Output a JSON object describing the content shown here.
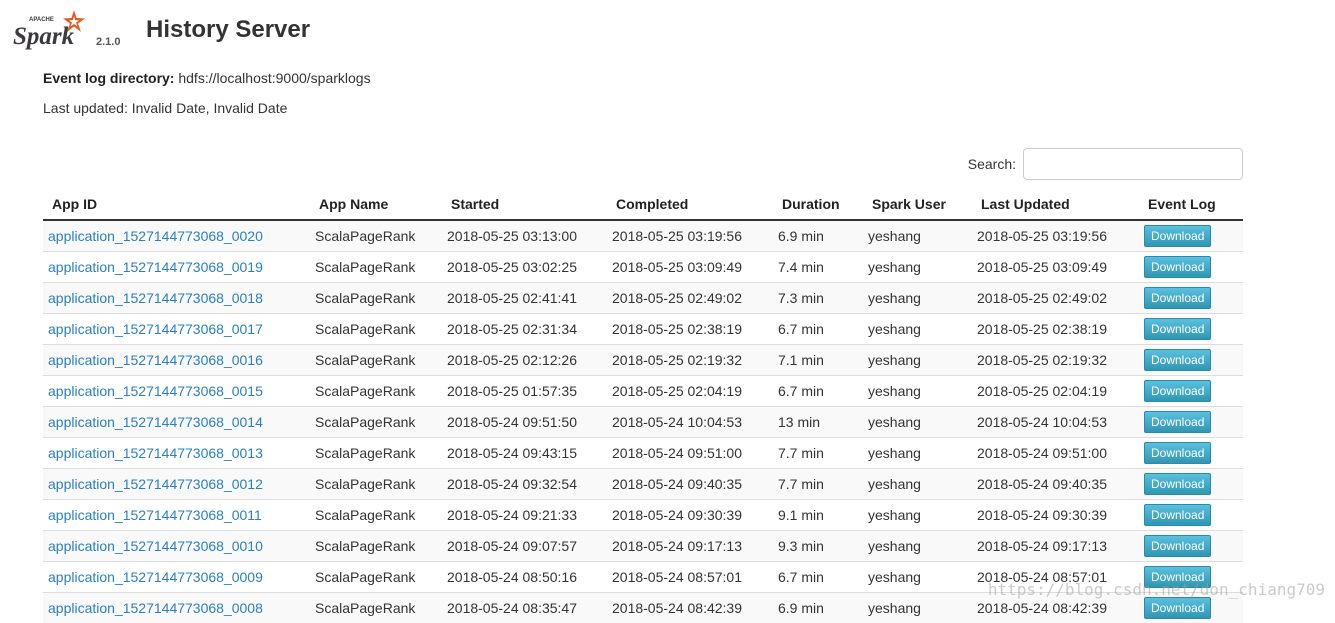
{
  "header": {
    "logo_apache": "APACHE",
    "logo_text": "Spark",
    "version": "2.1.0",
    "title": "History Server"
  },
  "info": {
    "event_log_label": "Event log directory:",
    "event_log_value": "hdfs://localhost:9000/sparklogs",
    "last_updated": "Last updated: Invalid Date, Invalid Date"
  },
  "search": {
    "label": "Search:",
    "value": "",
    "placeholder": ""
  },
  "table": {
    "columns": [
      "App ID",
      "App Name",
      "Started",
      "Completed",
      "Duration",
      "Spark User",
      "Last Updated",
      "Event Log"
    ],
    "download_label": "Download",
    "rows": [
      {
        "app_id": "application_1527144773068_0020",
        "app_name": "ScalaPageRank",
        "started": "2018-05-25 03:13:00",
        "completed": "2018-05-25 03:19:56",
        "duration": "6.9 min",
        "user": "yeshang",
        "last_updated": "2018-05-25 03:19:56"
      },
      {
        "app_id": "application_1527144773068_0019",
        "app_name": "ScalaPageRank",
        "started": "2018-05-25 03:02:25",
        "completed": "2018-05-25 03:09:49",
        "duration": "7.4 min",
        "user": "yeshang",
        "last_updated": "2018-05-25 03:09:49"
      },
      {
        "app_id": "application_1527144773068_0018",
        "app_name": "ScalaPageRank",
        "started": "2018-05-25 02:41:41",
        "completed": "2018-05-25 02:49:02",
        "duration": "7.3 min",
        "user": "yeshang",
        "last_updated": "2018-05-25 02:49:02"
      },
      {
        "app_id": "application_1527144773068_0017",
        "app_name": "ScalaPageRank",
        "started": "2018-05-25 02:31:34",
        "completed": "2018-05-25 02:38:19",
        "duration": "6.7 min",
        "user": "yeshang",
        "last_updated": "2018-05-25 02:38:19"
      },
      {
        "app_id": "application_1527144773068_0016",
        "app_name": "ScalaPageRank",
        "started": "2018-05-25 02:12:26",
        "completed": "2018-05-25 02:19:32",
        "duration": "7.1 min",
        "user": "yeshang",
        "last_updated": "2018-05-25 02:19:32"
      },
      {
        "app_id": "application_1527144773068_0015",
        "app_name": "ScalaPageRank",
        "started": "2018-05-25 01:57:35",
        "completed": "2018-05-25 02:04:19",
        "duration": "6.7 min",
        "user": "yeshang",
        "last_updated": "2018-05-25 02:04:19"
      },
      {
        "app_id": "application_1527144773068_0014",
        "app_name": "ScalaPageRank",
        "started": "2018-05-24 09:51:50",
        "completed": "2018-05-24 10:04:53",
        "duration": "13 min",
        "user": "yeshang",
        "last_updated": "2018-05-24 10:04:53"
      },
      {
        "app_id": "application_1527144773068_0013",
        "app_name": "ScalaPageRank",
        "started": "2018-05-24 09:43:15",
        "completed": "2018-05-24 09:51:00",
        "duration": "7.7 min",
        "user": "yeshang",
        "last_updated": "2018-05-24 09:51:00"
      },
      {
        "app_id": "application_1527144773068_0012",
        "app_name": "ScalaPageRank",
        "started": "2018-05-24 09:32:54",
        "completed": "2018-05-24 09:40:35",
        "duration": "7.7 min",
        "user": "yeshang",
        "last_updated": "2018-05-24 09:40:35"
      },
      {
        "app_id": "application_1527144773068_0011",
        "app_name": "ScalaPageRank",
        "started": "2018-05-24 09:21:33",
        "completed": "2018-05-24 09:30:39",
        "duration": "9.1 min",
        "user": "yeshang",
        "last_updated": "2018-05-24 09:30:39"
      },
      {
        "app_id": "application_1527144773068_0010",
        "app_name": "ScalaPageRank",
        "started": "2018-05-24 09:07:57",
        "completed": "2018-05-24 09:17:13",
        "duration": "9.3 min",
        "user": "yeshang",
        "last_updated": "2018-05-24 09:17:13"
      },
      {
        "app_id": "application_1527144773068_0009",
        "app_name": "ScalaPageRank",
        "started": "2018-05-24 08:50:16",
        "completed": "2018-05-24 08:57:01",
        "duration": "6.7 min",
        "user": "yeshang",
        "last_updated": "2018-05-24 08:57:01"
      },
      {
        "app_id": "application_1527144773068_0008",
        "app_name": "ScalaPageRank",
        "started": "2018-05-24 08:35:47",
        "completed": "2018-05-24 08:42:39",
        "duration": "6.9 min",
        "user": "yeshang",
        "last_updated": "2018-05-24 08:42:39"
      }
    ]
  },
  "watermark": "https://blog.csdn.net/don_chiang709",
  "colors": {
    "link": "#2a7fc3",
    "button": "#3aa0c8",
    "logo_orange": "#e25a1c",
    "logo_gray": "#3c3a3e"
  }
}
